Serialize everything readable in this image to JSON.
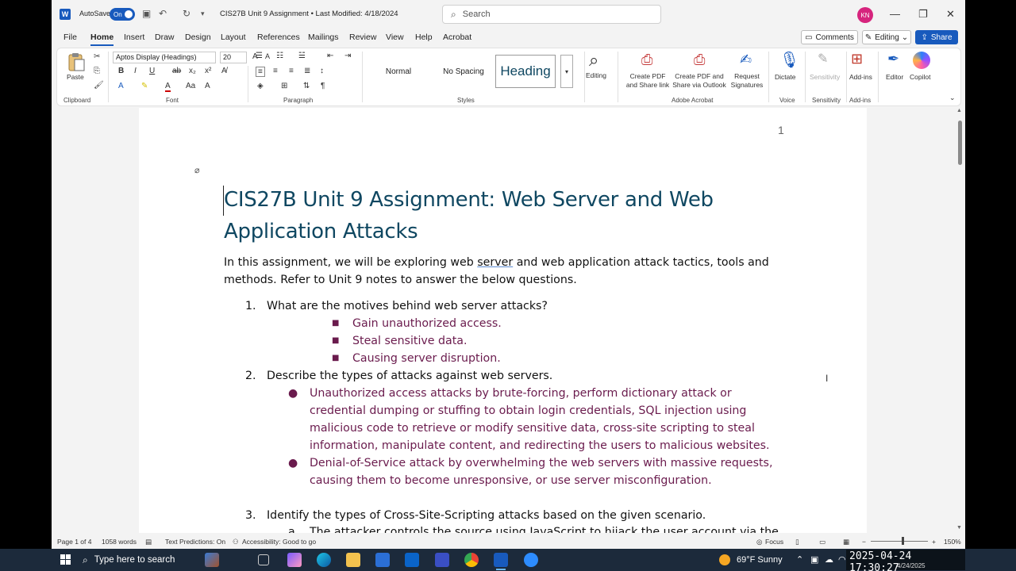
{
  "titlebar": {
    "autosave_label": "AutoSave",
    "autosave_state": "On",
    "document_title": "CIS27B Unit 9 Assignment • Last Modified: 4/18/2024",
    "search_placeholder": "Search",
    "avatar_initials": "KN"
  },
  "menu": {
    "tabs": [
      "File",
      "Home",
      "Insert",
      "Draw",
      "Design",
      "Layout",
      "References",
      "Mailings",
      "Review",
      "View",
      "Help",
      "Acrobat"
    ],
    "active": "Home",
    "comments_label": "Comments",
    "editing_label": "Editing",
    "share_label": "Share"
  },
  "ribbon": {
    "paste_label": "Paste",
    "font_name": "Aptos Display (Headings)",
    "font_size": "20",
    "styles": [
      "Normal",
      "No Spacing",
      "Heading"
    ],
    "editing_label": "Editing",
    "create_pdf_share_link": [
      "Create PDF",
      "and Share link"
    ],
    "create_pdf_outlook": [
      "Create PDF and",
      "Share via Outlook"
    ],
    "request_signatures": [
      "Request",
      "Signatures"
    ],
    "dictate_label": "Dictate",
    "sensitivity_label": "Sensitivity",
    "addins_label": "Add-ins",
    "editor_label": "Editor",
    "copilot_label": "Copilot",
    "group_labels": {
      "clipboard": "Clipboard",
      "font": "Font",
      "paragraph": "Paragraph",
      "styles": "Styles",
      "adobe": "Adobe Acrobat",
      "voice": "Voice",
      "sensitivity": "Sensitivity",
      "addins": "Add-ins"
    }
  },
  "document": {
    "page_number": "1",
    "title_line1": "CIS27B Unit 9 Assignment: Web Server and Web",
    "title_line2": "Application Attacks",
    "intro_before": "In this assignment, we will be exploring web ",
    "intro_underlined": "server",
    "intro_after": " and web application attack tactics, tools and methods. Refer to Unit 9 notes to answer the below questions.",
    "q1_num": "1.",
    "q1": "What are the motives behind web server attacks?",
    "q1_answers": [
      "Gain unauthorized access.",
      "Steal sensitive data.",
      "Causing server disruption."
    ],
    "q2_num": "2.",
    "q2": "Describe the types of attacks against web servers.",
    "q2_answer1": "Unauthorized access attacks by brute-forcing, perform dictionary attack or credential dumping or stuffing to obtain login credentials, SQL injection using malicious code to retrieve or modify sensitive data, cross-site scripting to steal information, manipulate content, and redirecting the users to malicious websites.",
    "q2_answer2": "Denial-of-Service attack by overwhelming the web servers with massive requests, causing them to become unresponsive, or use server misconfiguration.",
    "q3_num": "3.",
    "q3": "Identify the types of Cross-Site-Scripting attacks based on the given scenario.",
    "q3a_letter": "a.",
    "q3a": "The attacker controls the source using JavaScript to hijack the user account via the"
  },
  "statusbar": {
    "page": "Page 1 of 4",
    "words": "1058 words",
    "text_predictions": "Text Predictions: On",
    "accessibility": "Accessibility: Good to go",
    "focus": "Focus",
    "zoom": "150%"
  },
  "taskbar": {
    "search_placeholder": "Type here to search",
    "weather": "69°F  Sunny",
    "datetime_overlay": "2025-04-24 17:30:27",
    "date": "4/24/2025"
  },
  "colors": {
    "accent": "#185abd",
    "heading": "#0f4761",
    "answer": "#6a1b4d",
    "taskbar": "#1c2a3b"
  }
}
